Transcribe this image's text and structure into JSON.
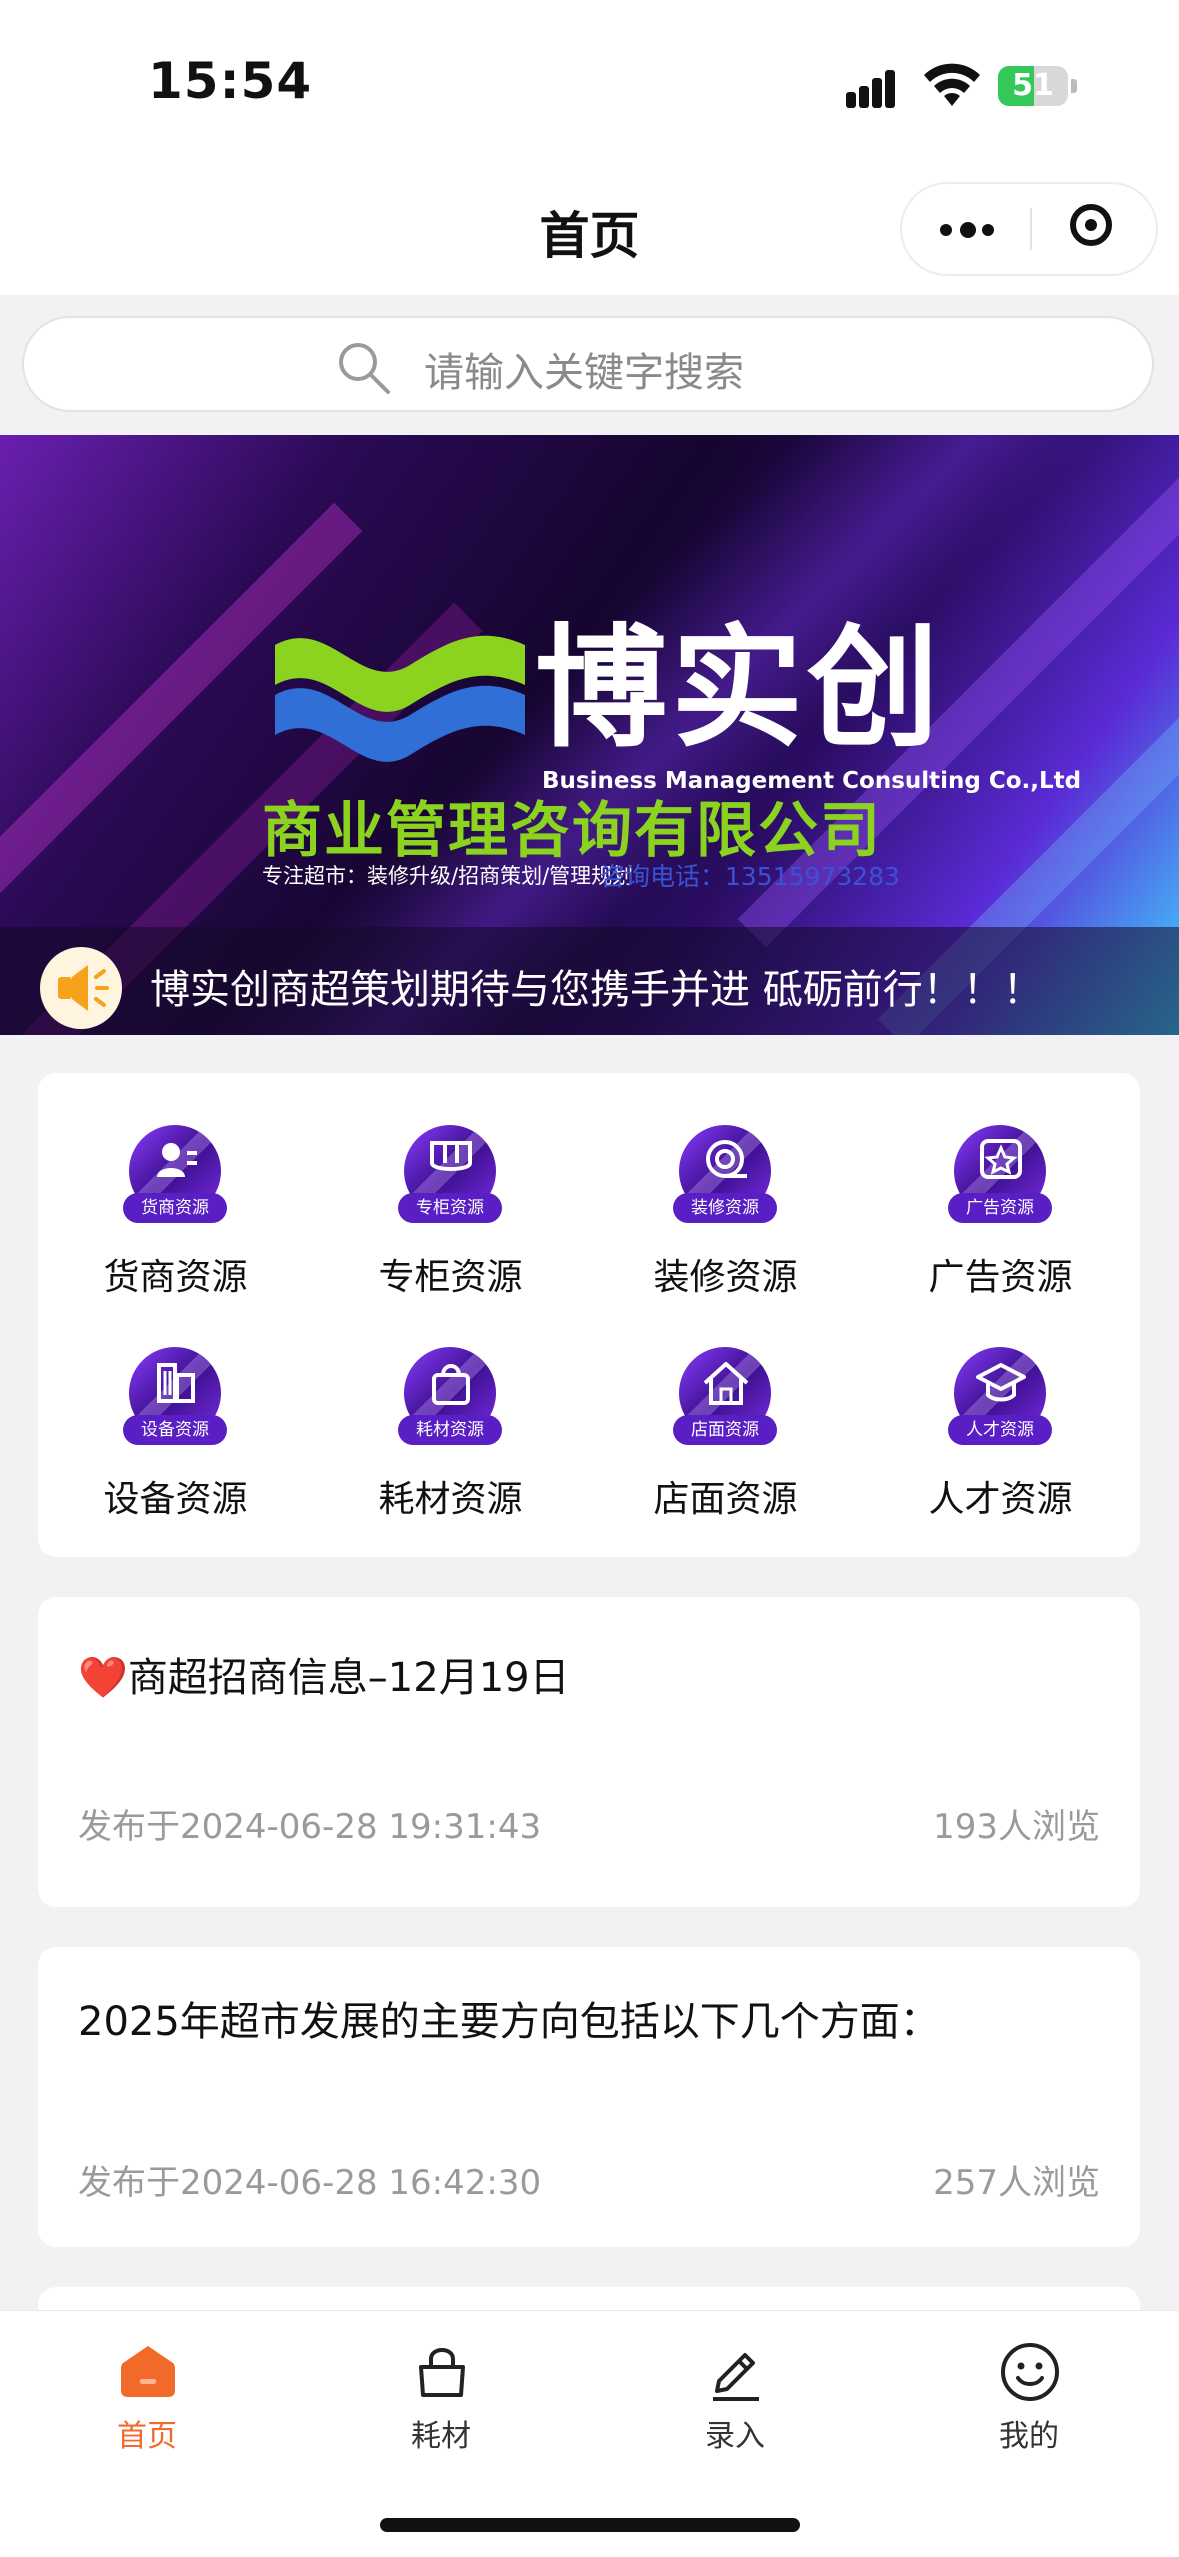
{
  "status_bar": {
    "time": "15:54",
    "battery": "51",
    "battery_level": 0.51
  },
  "nav": {
    "title": "首页"
  },
  "search": {
    "placeholder": "请输入关键字搜索"
  },
  "banner": {
    "logo_cn": "博实创",
    "logo_en": "Business Management Consulting Co.,Ltd",
    "company": "商业管理咨询有限公司",
    "slogan": "专注超市：装修升级/招商策划/管理规划",
    "phone": "咨询电话：13515973283",
    "notice": "博实创商超策划期待与您携手并进 砥砺前行！！！"
  },
  "categories": [
    {
      "label": "货商资源",
      "tag": "货商资源",
      "icon": "merchant-icon"
    },
    {
      "label": "专柜资源",
      "tag": "专柜资源",
      "icon": "counter-icon"
    },
    {
      "label": "装修资源",
      "tag": "装修资源",
      "icon": "tape-icon"
    },
    {
      "label": "广告资源",
      "tag": "广告资源",
      "icon": "star-icon"
    },
    {
      "label": "设备资源",
      "tag": "设备资源",
      "icon": "building-icon"
    },
    {
      "label": "耗材资源",
      "tag": "耗材资源",
      "icon": "bag-icon"
    },
    {
      "label": "店面资源",
      "tag": "店面资源",
      "icon": "house-icon"
    },
    {
      "label": "人才资源",
      "tag": "人才资源",
      "icon": "graduation-icon"
    }
  ],
  "articles": [
    {
      "title": "商超招商信息–12月19日",
      "date": "发布于2024-06-28 19:31:43",
      "views": "193人浏览",
      "emoji": "❤️"
    },
    {
      "title": "2025年超市发展的主要方向包括以下几个方面：",
      "date": "发布于2024-06-28 16:42:30",
      "views": "257人浏览"
    }
  ],
  "tabs": [
    {
      "label": "首页",
      "icon": "home-icon",
      "active": true
    },
    {
      "label": "耗材",
      "icon": "bag-icon",
      "active": false
    },
    {
      "label": "录入",
      "icon": "edit-icon",
      "active": false
    },
    {
      "label": "我的",
      "icon": "smile-icon",
      "active": false
    }
  ],
  "colors": {
    "accent": "#f26a2a",
    "icon_purple": "#5a1fc4",
    "banner_green": "#8bd31e"
  }
}
